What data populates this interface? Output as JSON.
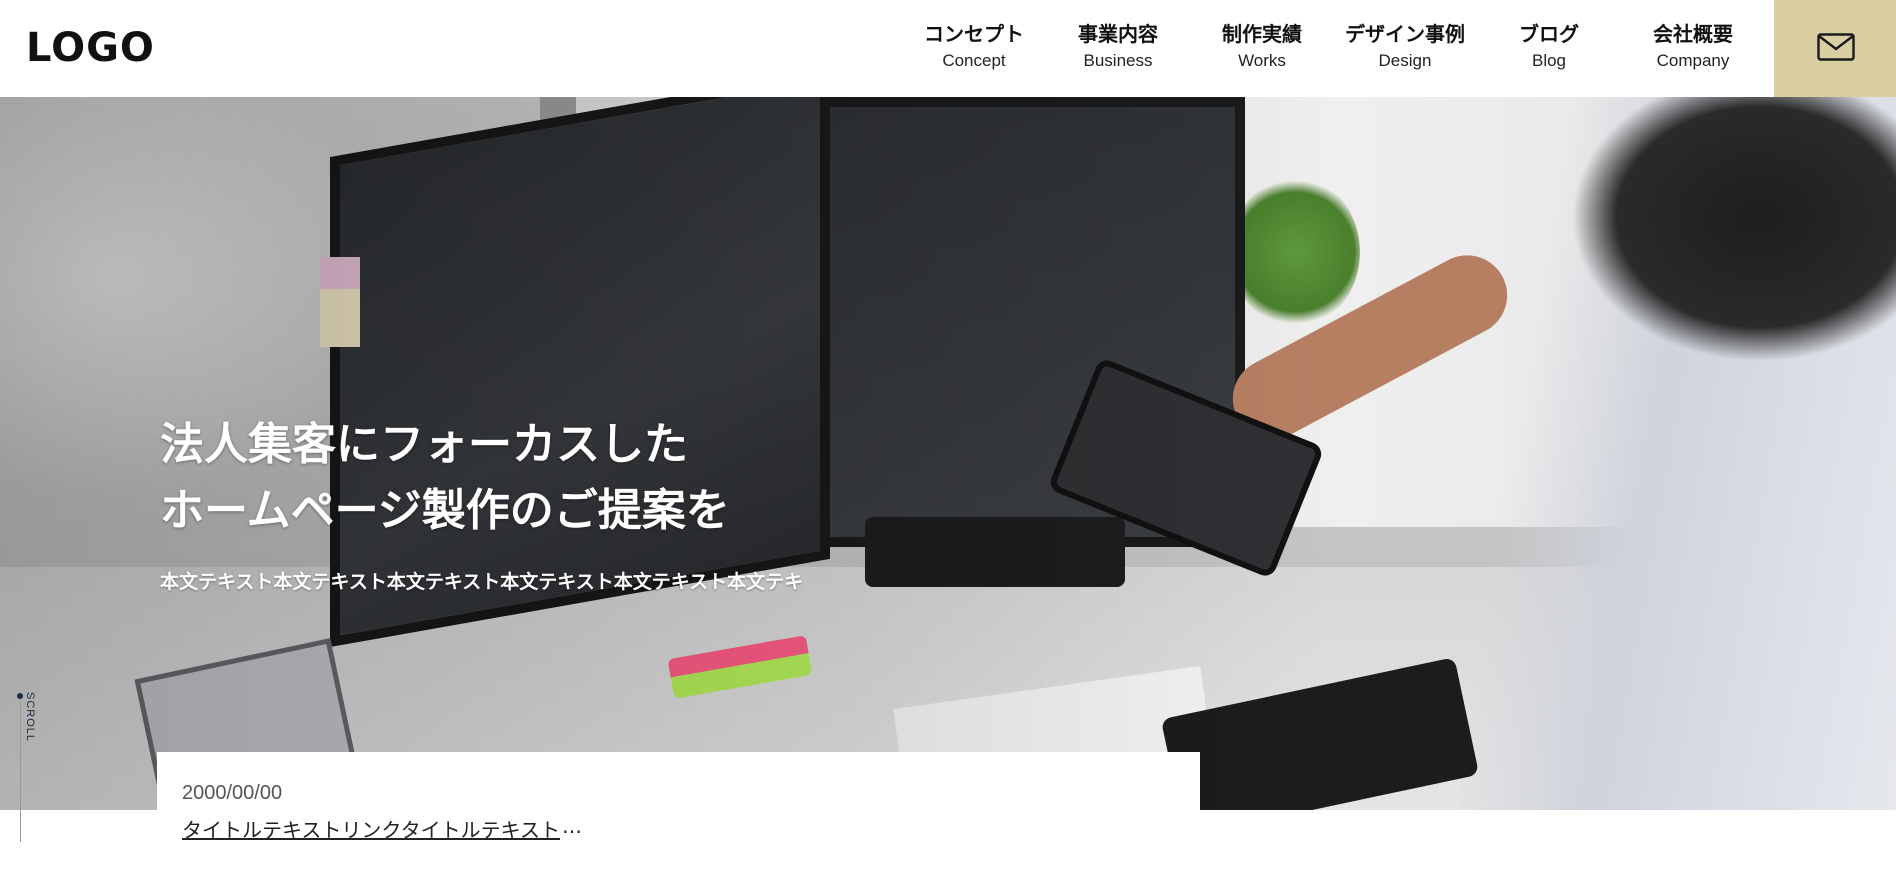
{
  "header": {
    "logo": "LOGO",
    "nav": [
      {
        "ja": "コンセプト",
        "en": "Concept"
      },
      {
        "ja": "事業内容",
        "en": "Business"
      },
      {
        "ja": "制作実績",
        "en": "Works"
      },
      {
        "ja": "デザイン事例",
        "en": "Design"
      },
      {
        "ja": "ブログ",
        "en": "Blog"
      },
      {
        "ja": "会社概要",
        "en": "Company"
      }
    ],
    "contact_icon": "mail-icon",
    "contact_bg": "#d9cfa3"
  },
  "hero": {
    "title_line1": "法人集客にフォーカスした",
    "title_line2": "ホームページ製作のご提案を",
    "body": "本文テキスト本文テキスト本文テキスト本文テキスト本文テキスト本文テキ"
  },
  "scroll": {
    "label": "SCROLL"
  },
  "news": {
    "date": "2000/00/00",
    "link_text": "タイトルテキストリンクタイトルテキスト",
    "ellipsis": "…"
  }
}
